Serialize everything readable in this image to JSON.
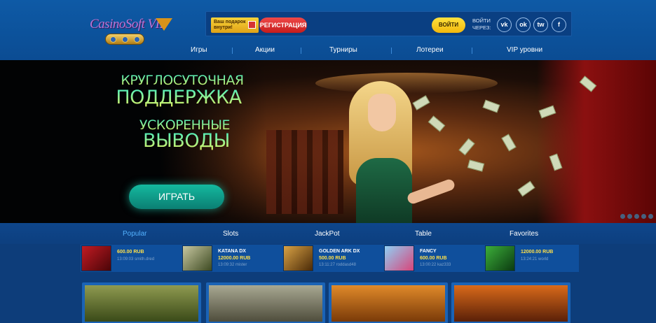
{
  "header": {
    "logo_text": "CasinoSoft VIP",
    "gift_label": "Ваш подарок внутри!",
    "register_label": "РЕГИСТРАЦИЯ",
    "login_label": "ВОЙТИ",
    "login_via_label": "ВОЙТИ ЧЕРЕЗ:",
    "social": [
      {
        "label": "vk",
        "icon": "vk-icon"
      },
      {
        "label": "ok",
        "icon": "odnoklassniki-icon"
      },
      {
        "label": "tw",
        "icon": "twitter-icon"
      },
      {
        "label": "f",
        "icon": "facebook-icon"
      }
    ]
  },
  "nav": {
    "items": [
      "Игры",
      "Акции",
      "Турниры",
      "Лотереи",
      "VIP уровни"
    ]
  },
  "hero": {
    "line1": "КРУГЛОСУТОЧНАЯ",
    "line2": "ПОДДЕРЖКА",
    "line3": "УСКОРЕННЫЕ",
    "line4": "ВЫВОДЫ",
    "play_label": "ИГРАТЬ",
    "slide_count": 5
  },
  "tabs": {
    "items": [
      "Popular",
      "Slots",
      "JackPot",
      "Table",
      "Favorites"
    ],
    "active": "Popular"
  },
  "winners": [
    {
      "name": "",
      "amount": "600.00 RUB",
      "meta": "13:09:03 smith.dred",
      "thumb_color": "#8a0f14"
    },
    {
      "name": "KATANA DX",
      "amount": "12000.00 RUB",
      "meta": "13:09:32 mister",
      "thumb_color": "#5a6b3a"
    },
    {
      "name": "GOLDEN ARK DX",
      "amount": "500.00 RUB",
      "meta": "13:11:27 roddasd48",
      "thumb_color": "#7a4a12"
    },
    {
      "name": "FANCY",
      "amount": "600.00 RUB",
      "meta": "13:00:22 kaz333",
      "thumb_color": "#3a8fd0"
    },
    {
      "name": "",
      "amount": "12000.00 RUB",
      "meta": "13:24:21 world",
      "thumb_color": "#1f7a2a"
    }
  ],
  "colors": {
    "accent_blue": "#54b2ff",
    "register_red": "#e03232",
    "login_yellow": "#ffd21f",
    "play_teal": "#14b99f"
  }
}
